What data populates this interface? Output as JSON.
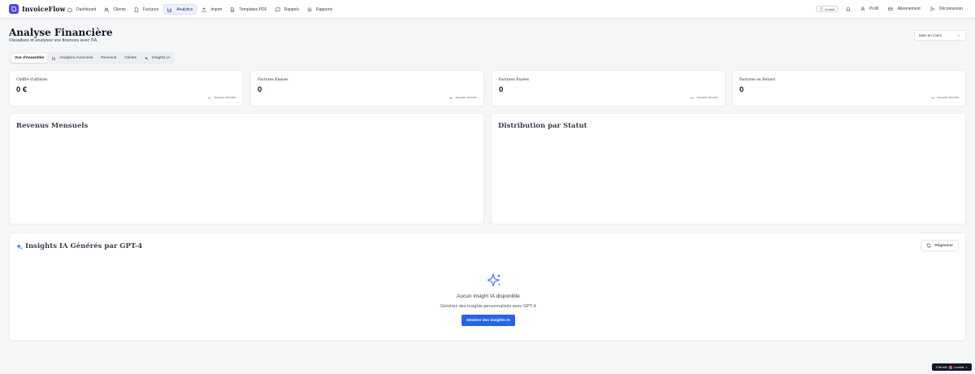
{
  "app": {
    "name": "InvoiceFlow",
    "brand_color": "#4f46e5"
  },
  "nav": {
    "items": [
      {
        "label": "Dashboard",
        "icon": "home-icon"
      },
      {
        "label": "Clients",
        "icon": "users-icon"
      },
      {
        "label": "Factures",
        "icon": "file-icon"
      },
      {
        "label": "Analytics",
        "icon": "bar-chart-icon",
        "active": true
      },
      {
        "label": "Import",
        "icon": "upload-icon"
      },
      {
        "label": "Templates PDF",
        "icon": "file-icon"
      },
      {
        "label": "Rappels",
        "icon": "message-icon"
      },
      {
        "label": "Rapports",
        "icon": "gear-icon"
      }
    ],
    "plan_badge": "Gratuit",
    "profile_label": "Profil",
    "subscription_label": "Abonnement",
    "logout_label": "Déconnexion"
  },
  "page": {
    "title": "Analyse Financière",
    "subtitle": "Visualisez et analysez vos finances avec l'IA",
    "period_select": "Mois en cours"
  },
  "tabs": [
    "Vue d'ensemble",
    "Analytics Avancées",
    "Revenus",
    "Clients",
    "Insights IA"
  ],
  "kpis": [
    {
      "label": "Chiffre d'affaires",
      "value": "0 €",
      "trend": "Aucune donnée"
    },
    {
      "label": "Factures Émises",
      "value": "0",
      "trend": "Aucune donnée"
    },
    {
      "label": "Factures Payées",
      "value": "0",
      "trend": "Aucune donnée"
    },
    {
      "label": "Factures en Retard",
      "value": "0",
      "trend": "Aucune donnée"
    }
  ],
  "charts": {
    "revenue_title": "Revenus Mensuels",
    "status_title": "Distribution par Statut"
  },
  "insights": {
    "title": "Insights IA Générés par GPT-4",
    "regenerate_label": "Régénérer",
    "empty_title": "Aucun insight IA disponible",
    "empty_subtitle": "Générez des insights personnalisés avec GPT-4",
    "generate_label": "Générer des insights IA",
    "accent_color": "#2563eb"
  },
  "badge": {
    "label": "Edit with",
    "brand": "Lovable"
  }
}
